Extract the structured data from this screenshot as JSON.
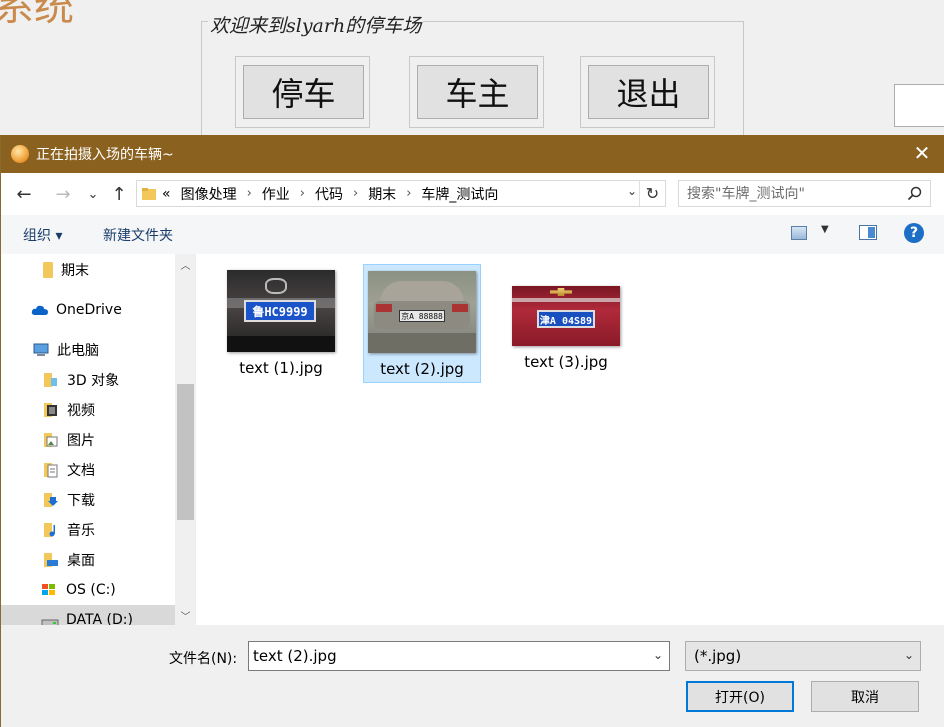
{
  "background_app": {
    "title_fragment": "系统",
    "group_legend": "欢迎来到slyarh的停车场",
    "buttons": [
      "停车",
      "车主",
      "退出"
    ]
  },
  "dialog": {
    "title": "正在拍摄入场的车辆~",
    "close_glyph": "✕",
    "nav": {
      "back": "←",
      "forward": "→",
      "recent": "⌄",
      "up": "↑"
    },
    "breadcrumb": [
      "图像处理",
      "作业",
      "代码",
      "期末",
      "车牌_测试向"
    ],
    "breadcrumb_prefix": "«",
    "search_placeholder": "搜索\"车牌_测试向\"",
    "commands": {
      "organize": "组织 ▾",
      "new_folder": "新建文件夹",
      "help": "?"
    },
    "tree": [
      {
        "label": "期末",
        "icon": "folder-icon"
      },
      {
        "label": "OneDrive",
        "icon": "cloud-icon"
      },
      {
        "label": "此电脑",
        "icon": "computer-icon"
      },
      {
        "label": "3D 对象",
        "icon": "3d-objects-icon"
      },
      {
        "label": "视频",
        "icon": "video-icon"
      },
      {
        "label": "图片",
        "icon": "pictures-icon"
      },
      {
        "label": "文档",
        "icon": "documents-icon"
      },
      {
        "label": "下载",
        "icon": "downloads-icon"
      },
      {
        "label": "音乐",
        "icon": "music-icon"
      },
      {
        "label": "桌面",
        "icon": "desktop-icon"
      },
      {
        "label": "OS (C:)",
        "icon": "drive-c-icon"
      },
      {
        "label": "DATA (D:)",
        "icon": "drive-d-icon"
      }
    ],
    "files": [
      {
        "name": "text (1).jpg",
        "plate": "鲁HC9999",
        "selected": false
      },
      {
        "name": "text (2).jpg",
        "plate": "京A 88888",
        "selected": true
      },
      {
        "name": "text (3).jpg",
        "plate": "津A 04S89",
        "selected": false
      }
    ],
    "footer": {
      "filename_label": "文件名(N):",
      "filename_value": "text (2).jpg",
      "filetype_value": "(*.jpg)",
      "open_label": "打开(O)",
      "cancel_label": "取消"
    }
  },
  "colors": {
    "titlebar": "#8b6120",
    "selection": "#cce8ff",
    "accent": "#0078d7"
  }
}
